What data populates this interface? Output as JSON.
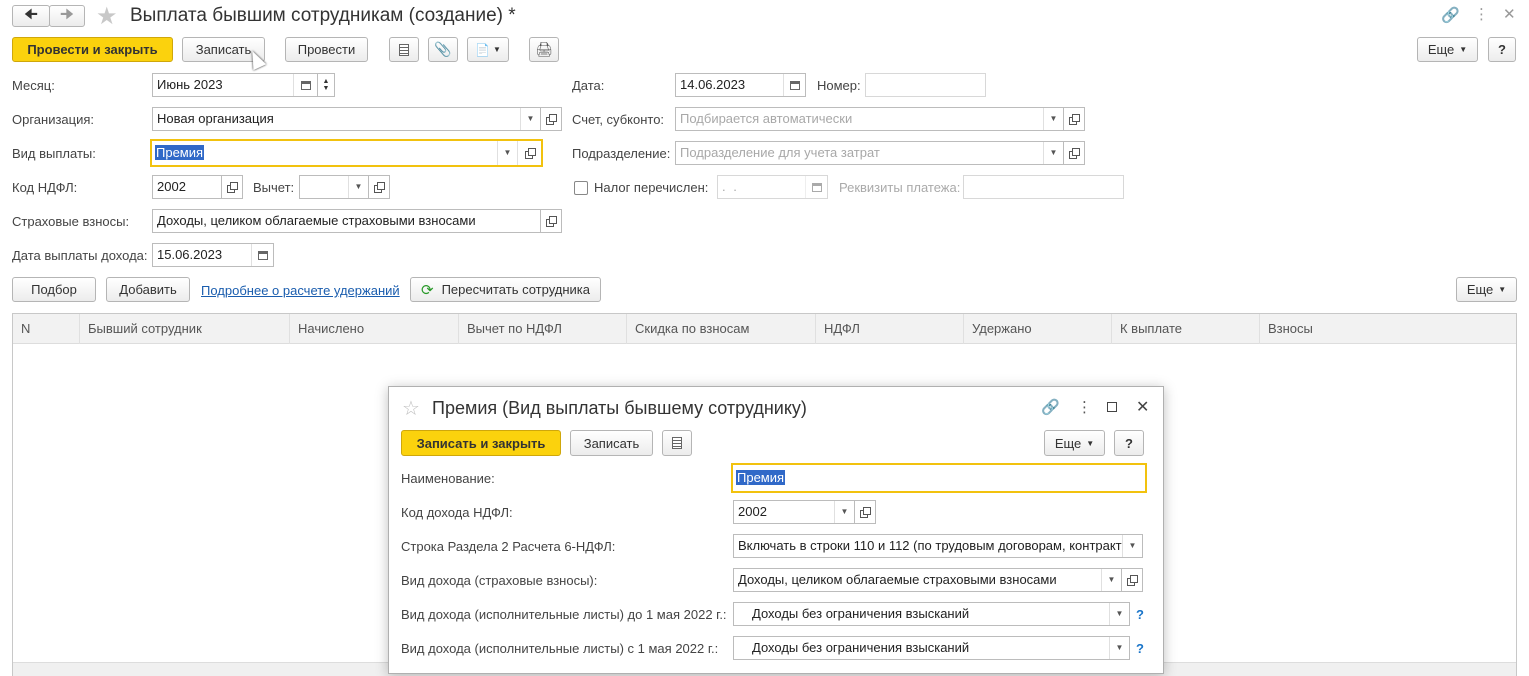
{
  "window": {
    "title": "Выплата бывшим сотрудникам (создание) *"
  },
  "toolbar": {
    "post_close": "Провести и закрыть",
    "save": "Записать",
    "post": "Провести",
    "more": "Еще",
    "help": "?"
  },
  "form": {
    "month_label": "Месяц:",
    "month_value": "Июнь 2023",
    "org_label": "Организация:",
    "org_value": "Новая организация",
    "paytype_label": "Вид выплаты:",
    "paytype_value": "Премия",
    "ndfl_code_label": "Код НДФЛ:",
    "ndfl_code_value": "2002",
    "deduction_label": "Вычет:",
    "deduction_value": "",
    "insurance_label": "Страховые взносы:",
    "insurance_value": "Доходы, целиком облагаемые страховыми взносами",
    "income_date_label": "Дата выплаты дохода:",
    "income_date_value": "15.06.2023",
    "date_label": "Дата:",
    "date_value": "14.06.2023",
    "number_label": "Номер:",
    "number_value": "",
    "account_label": "Счет, субконто:",
    "account_placeholder": "Подбирается автоматически",
    "dept_label": "Подразделение:",
    "dept_placeholder": "Подразделение для учета затрат",
    "tax_paid_label": "Налог перечислен:",
    "tax_paid_date": " .  .",
    "payment_details_label": "Реквизиты платежа:",
    "payment_details_value": ""
  },
  "table_toolbar": {
    "pick": "Подбор",
    "add": "Добавить",
    "details_link": "Подробнее о расчете удержаний",
    "recalc": "Пересчитать сотрудника",
    "more": "Еще"
  },
  "table": {
    "columns": [
      "N",
      "Бывший сотрудник",
      "Начислено",
      "Вычет по НДФЛ",
      "Скидка по взносам",
      "НДФЛ",
      "Удержано",
      "К выплате",
      "Взносы"
    ]
  },
  "dialog": {
    "title": "Премия (Вид выплаты бывшему сотруднику)",
    "save_close": "Записать и закрыть",
    "save": "Записать",
    "more": "Еще",
    "help": "?",
    "name_label": "Наименование:",
    "name_value": "Премия",
    "ndfl_code_label": "Код дохода НДФЛ:",
    "ndfl_code_value": "2002",
    "row_label": "Строка Раздела 2 Расчета 6-НДФЛ:",
    "row_value": "Включать в строки 110 и 112 (по трудовым договорам, контракт",
    "insurance_label": "Вид дохода (страховые взносы):",
    "insurance_value": "Доходы, целиком облагаемые страховыми взносами",
    "exec_before_label": "Вид дохода (исполнительные листы) до 1 мая 2022 г.:",
    "exec_before_value": "Доходы без ограничения взысканий",
    "exec_after_label": "Вид дохода (исполнительные листы) с 1 мая 2022 г.:",
    "exec_after_value": "Доходы без ограничения взысканий",
    "qmark": "?"
  }
}
